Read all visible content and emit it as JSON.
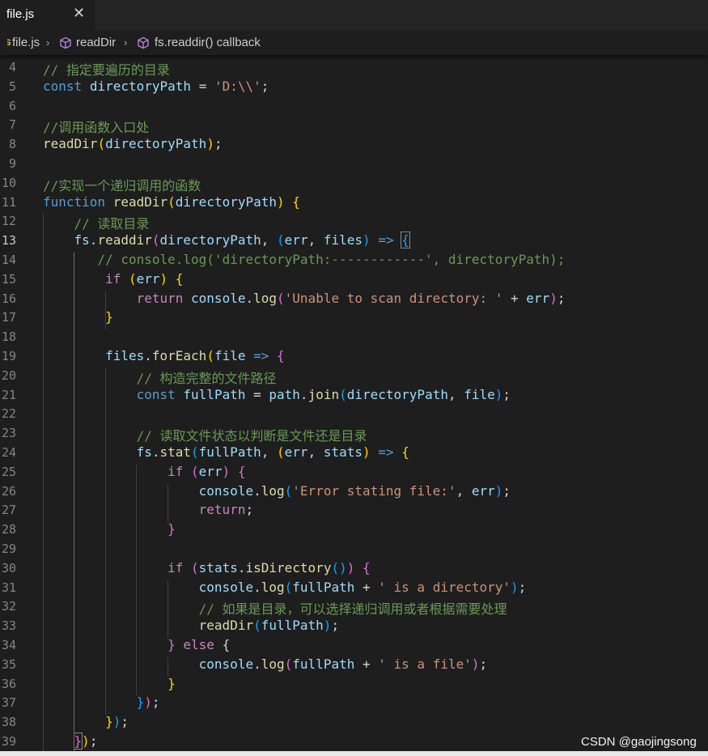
{
  "tab": {
    "label": "file.js",
    "close": "✕"
  },
  "breadcrumb": {
    "js_badge": "JS",
    "file": "file.js",
    "sep": "›",
    "item1": "readDir",
    "item2": "fs.readdir() callback"
  },
  "editor": {
    "active_line": 13,
    "lines": [
      {
        "n": 4,
        "code": "// 指定要遍历的目录"
      },
      {
        "n": 5,
        "code": "const directoryPath = 'D:\\\\';"
      },
      {
        "n": 6,
        "code": ""
      },
      {
        "n": 7,
        "code": "//调用函数入口处"
      },
      {
        "n": 8,
        "code": "readDir(directoryPath);"
      },
      {
        "n": 9,
        "code": ""
      },
      {
        "n": 10,
        "code": "//实现一个递归调用的函数"
      },
      {
        "n": 11,
        "code": "function readDir(directoryPath) {"
      },
      {
        "n": 12,
        "code": "    // 读取目录"
      },
      {
        "n": 13,
        "code": "    fs.readdir(directoryPath, (err, files) => {"
      },
      {
        "n": 14,
        "code": "       // console.log('directoryPath:------------', directoryPath);"
      },
      {
        "n": 15,
        "code": "        if (err) {"
      },
      {
        "n": 16,
        "code": "            return console.log('Unable to scan directory: ' + err);"
      },
      {
        "n": 17,
        "code": "        }"
      },
      {
        "n": 18,
        "code": ""
      },
      {
        "n": 19,
        "code": "        files.forEach(file => {"
      },
      {
        "n": 20,
        "code": "            // 构造完整的文件路径"
      },
      {
        "n": 21,
        "code": "            const fullPath = path.join(directoryPath, file);"
      },
      {
        "n": 22,
        "code": ""
      },
      {
        "n": 23,
        "code": "            // 读取文件状态以判断是文件还是目录"
      },
      {
        "n": 24,
        "code": "            fs.stat(fullPath, (err, stats) => {"
      },
      {
        "n": 25,
        "code": "                if (err) {"
      },
      {
        "n": 26,
        "code": "                    console.log('Error stating file:', err);"
      },
      {
        "n": 27,
        "code": "                    return;"
      },
      {
        "n": 28,
        "code": "                }"
      },
      {
        "n": 29,
        "code": ""
      },
      {
        "n": 30,
        "code": "                if (stats.isDirectory()) {"
      },
      {
        "n": 31,
        "code": "                    console.log(fullPath + ' is a directory');"
      },
      {
        "n": 32,
        "code": "                    // 如果是目录，可以选择递归调用或者根据需要处理"
      },
      {
        "n": 33,
        "code": "                    readDir(fullPath);"
      },
      {
        "n": 34,
        "code": "                } else {"
      },
      {
        "n": 35,
        "code": "                    console.log(fullPath + ' is a file');"
      },
      {
        "n": 36,
        "code": "                }"
      },
      {
        "n": 37,
        "code": "            });"
      },
      {
        "n": 38,
        "code": "        });"
      },
      {
        "n": 39,
        "code": "    });"
      }
    ]
  },
  "watermark": "CSDN @gaojingsong",
  "colors": {
    "background": "#1e1e1e",
    "comment": "#6a9955",
    "keyword": "#569cd6",
    "control": "#c586c0",
    "function": "#dcdcaa",
    "variable": "#9cdcfe",
    "string": "#ce9178",
    "bracket1": "#ffd700",
    "bracket2": "#da70d6",
    "bracket3": "#179fff"
  }
}
